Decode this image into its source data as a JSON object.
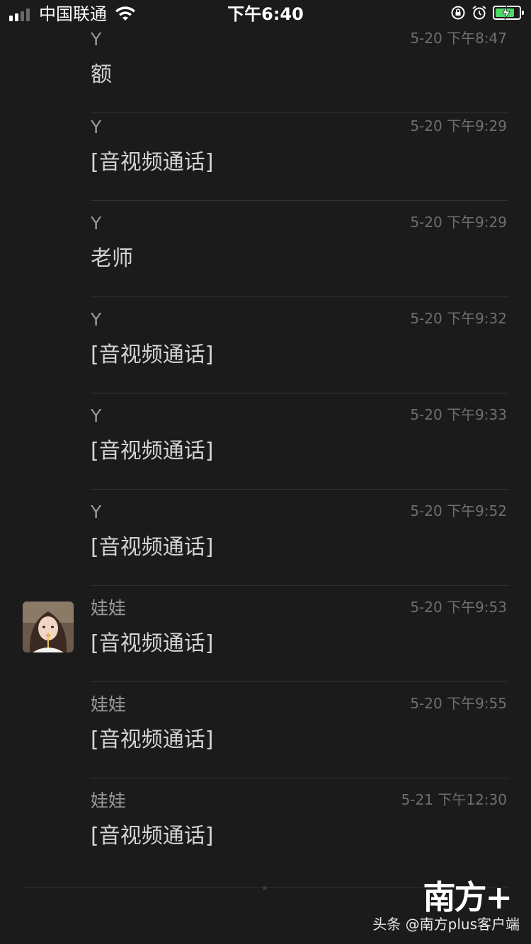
{
  "status_bar": {
    "carrier": "中国联通",
    "time": "下午6:40",
    "signal_bars_filled": 2,
    "signal_bars_total": 4,
    "battery_color": "#4cd964",
    "icons": [
      "signal-icon",
      "wifi-icon",
      "orientation-lock-icon",
      "alarm-icon",
      "battery-charging-icon"
    ]
  },
  "messages": [
    {
      "sender": "Y",
      "time": "5-20 下午8:47",
      "content": "额",
      "has_avatar": false
    },
    {
      "sender": "Y",
      "time": "5-20 下午9:29",
      "content": "[音视频通话]",
      "has_avatar": false
    },
    {
      "sender": "Y",
      "time": "5-20 下午9:29",
      "content": "老师",
      "has_avatar": false
    },
    {
      "sender": "Y",
      "time": "5-20 下午9:32",
      "content": "[音视频通话]",
      "has_avatar": false
    },
    {
      "sender": "Y",
      "time": "5-20 下午9:33",
      "content": "[音视频通话]",
      "has_avatar": false
    },
    {
      "sender": "Y",
      "time": "5-20 下午9:52",
      "content": "[音视频通话]",
      "has_avatar": false
    },
    {
      "sender": "娃娃",
      "time": "5-20 下午9:53",
      "content": "[音视频通话]",
      "has_avatar": true
    },
    {
      "sender": "娃娃",
      "time": "5-20 下午9:55",
      "content": "[音视频通话]",
      "has_avatar": false
    },
    {
      "sender": "娃娃",
      "time": "5-21 下午12:30",
      "content": "[音视频通话]",
      "has_avatar": false
    }
  ],
  "watermark": {
    "logo": "南方+",
    "caption": "头条 @南方plus客户端"
  }
}
